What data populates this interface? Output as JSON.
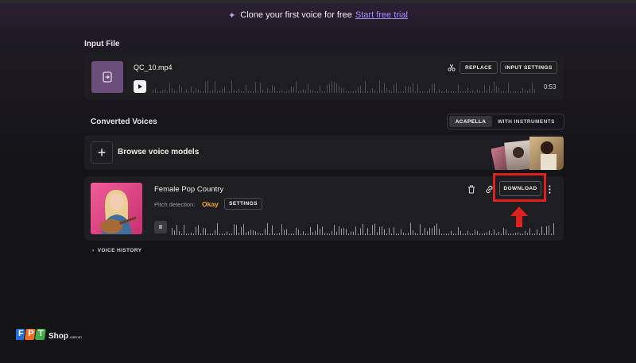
{
  "banner": {
    "text": "Clone your first voice for free",
    "link": "Start free trial"
  },
  "input_file": {
    "section_title": "Input File",
    "file_name": "QC_10.mp4",
    "duration": "0:53",
    "replace_label": "REPLACE",
    "input_settings_label": "INPUT SETTINGS"
  },
  "converted": {
    "section_title": "Converted Voices",
    "toggle_acapella": "ACAPELLA",
    "toggle_instruments": "WITH INSTRUMENTS",
    "browse_label": "Browse voice models"
  },
  "voice_card": {
    "name": "Female Pop Country",
    "pitch_label": "Pitch detection:",
    "pitch_value": "Okay",
    "settings_label": "SETTINGS",
    "download_label": "DOWNLOAD",
    "pause_glyph": "II"
  },
  "voice_history": "VOICE HISTORY",
  "watermark": {
    "brand": "FPT",
    "shop": "Shop",
    "domain": ".com.vn"
  },
  "colors": {
    "accent_link": "#a98cff",
    "highlight_red": "#e0201c",
    "pitch_okay": "#f5a524",
    "fpt_blue": "#1e6fd9",
    "fpt_orange": "#f26b21",
    "fpt_green": "#3fae49"
  }
}
